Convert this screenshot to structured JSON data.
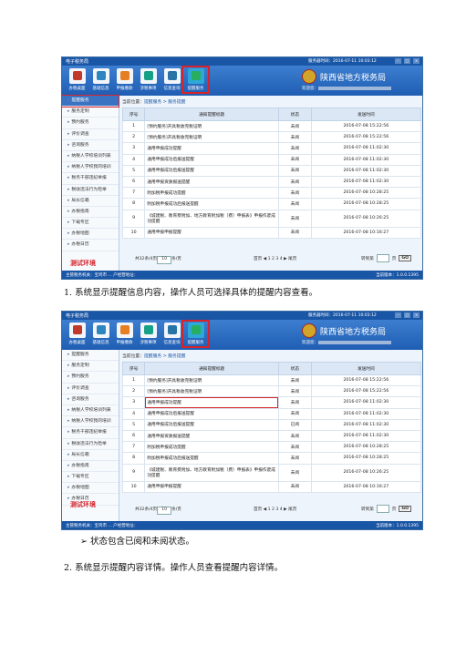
{
  "window": {
    "title": "电子税务局",
    "status_text": "服务器时间：2016-07-11 10:03:12",
    "brand": "陕西省地方税务局",
    "welcome": "欢迎您："
  },
  "toolbar": [
    "办税桌面",
    "基础信息",
    "申报缴款",
    "涉税事项",
    "信息查询",
    "提醒服务"
  ],
  "sidebar_items": [
    "提醒服务",
    "服务定制",
    "预约服务",
    "评价调查",
    "咨询服务",
    "纳税人学校培训列表",
    "纳税人学校我的培训",
    "税务干部违纪举报",
    "税收违法行为检举",
    "局长信箱",
    "办税指南",
    "下载专区",
    "办税地图",
    "办税日历"
  ],
  "breadcrumb": {
    "prefix": "当前位置：",
    "path": "提醒服务 > 服务提醒"
  },
  "table": {
    "headers": [
      "序号",
      "通知提醒标题",
      "状态",
      "发送时间"
    ],
    "rows1": [
      [
        "1",
        "[预约服务]开具税收完税证明",
        "未阅",
        "2016-07-08 15:22:56"
      ],
      [
        "2",
        "[预约服务]开具税收完税证明",
        "未阅",
        "2016-07-08 15:22:56"
      ],
      [
        "3",
        "通用申报成功提醒",
        "未阅",
        "2016-07-08 11:02:30"
      ],
      [
        "4",
        "通用申报成功后报送提醒",
        "未阅",
        "2016-07-08 11:02:30"
      ],
      [
        "5",
        "通用申报成功后报送提醒",
        "未阅",
        "2016-07-08 11:02:30"
      ],
      [
        "6",
        "通用申报资质报送提醒",
        "未阅",
        "2016-07-08 11:02:30"
      ],
      [
        "7",
        "附加税申报成功提醒",
        "未阅",
        "2016-07-08 10:28:25"
      ],
      [
        "8",
        "附加税申报成功后报送提醒",
        "未阅",
        "2016-07-08 10:28:25"
      ],
      [
        "9",
        "《城建税、教育费附加、地方教育附加税（费）申报表》申报作废成功提醒",
        "未阅",
        "2016-07-08 10:26:25"
      ],
      [
        "10",
        "通用申报申报提醒",
        "未阅",
        "2016-07-08 10:16:27"
      ]
    ],
    "rows2": [
      [
        "1",
        "[预约服务]开具税收完税证明",
        "未阅",
        "2016-07-08 15:22:56"
      ],
      [
        "2",
        "[预约服务]开具税收完税证明",
        "未阅",
        "2016-07-08 15:22:56"
      ],
      [
        "3",
        "通用申报成功提醒",
        "未阅",
        "2016-07-08 11:02:30"
      ],
      [
        "4",
        "通用申报成功后报送提醒",
        "未阅",
        "2016-07-08 11:02:30"
      ],
      [
        "5",
        "通用申报成功后报送提醒",
        "已阅",
        "2016-07-08 11:02:30"
      ],
      [
        "6",
        "通用申报资质报送提醒",
        "未阅",
        "2016-07-08 11:02:30"
      ],
      [
        "7",
        "附加税申报成功提醒",
        "未阅",
        "2016-07-08 10:28:25"
      ],
      [
        "8",
        "附加税申报成功后报送提醒",
        "未阅",
        "2016-07-08 10:28:25"
      ],
      [
        "9",
        "《城建税、教育费附加、地方教育附加税（费）申报表》申报作废成功提醒",
        "未阅",
        "2016-07-08 10:26:25"
      ],
      [
        "10",
        "通用申报申报提醒",
        "未阅",
        "2016-07-08 10:16:27"
      ]
    ]
  },
  "pager": {
    "total_prefix": "共32条/4页",
    "per_page": "10",
    "per_page_suffix": "条/页",
    "pages": "首页 ◀ 1  2  3  4 ▶ 尾页",
    "goto_label": "转到第",
    "goto_suffix": "页",
    "go": "GO"
  },
  "statusbar": {
    "left": "主管税务机关：宝鸡市 ... 户经营地址：",
    "right": "当前版本：1.0.0.1395"
  },
  "watermark": "测试环境",
  "doc": {
    "step1": "1.   系统显示提醒信息内容，操作人员可选择具体的提醒内容查看。",
    "bullet": "➢   状态包含已阅和未阅状态。",
    "step2": "2.   系统显示提醒内容详情。操作人员查看提醒内容详情。"
  },
  "colors": {
    "accent": "#1a56a6",
    "highlight": "#d6242a"
  }
}
